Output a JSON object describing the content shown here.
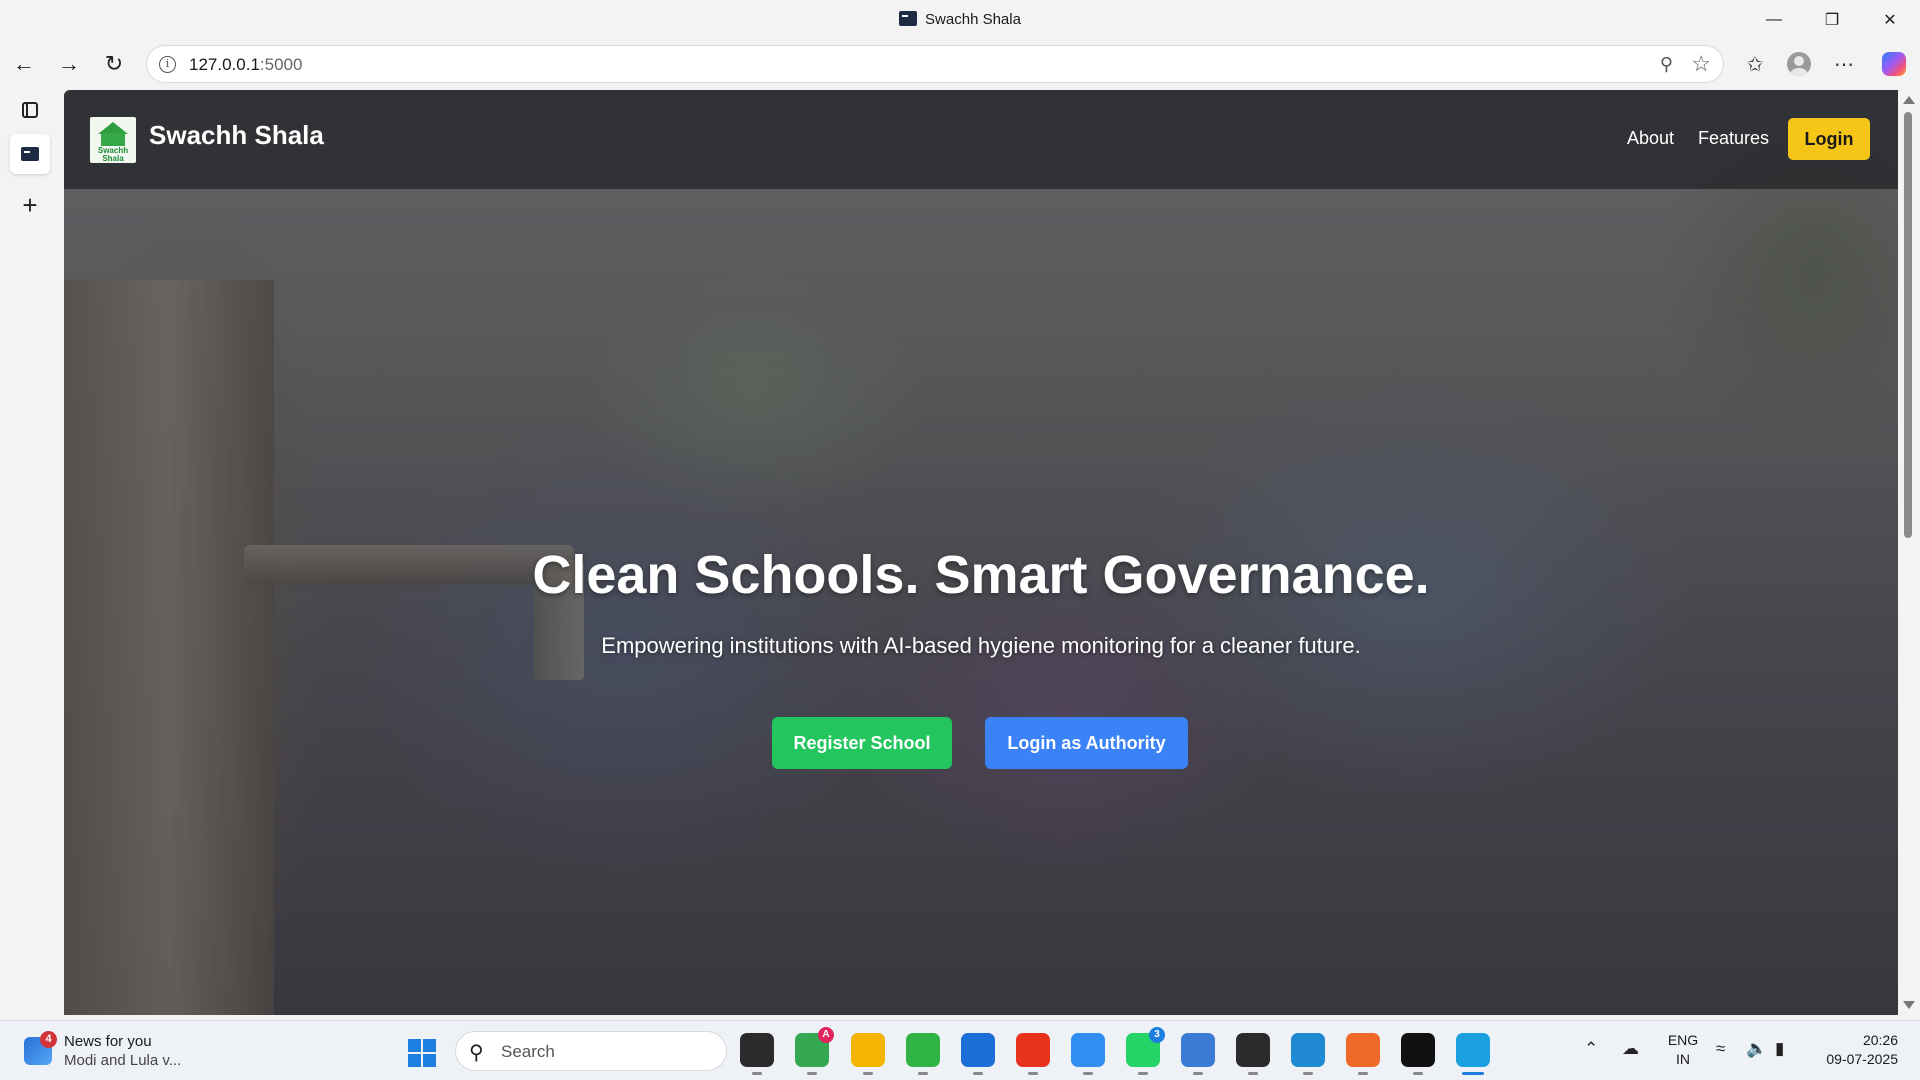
{
  "browser": {
    "window_title": "Swachh Shala",
    "url_host": "127.0.0.1",
    "url_port": ":5000"
  },
  "site": {
    "logo_text": [
      "Swachh",
      "Shala"
    ],
    "brand": "Swachh Shala",
    "nav": {
      "about": "About",
      "features": "Features",
      "login": "Login"
    },
    "hero": {
      "title": "Clean Schools. Smart Governance.",
      "subtitle": "Empowering institutions with AI-based hygiene monitoring for a cleaner future.",
      "register_button": "Register School",
      "authority_button": "Login as Authority"
    }
  },
  "taskbar": {
    "news": {
      "badge": "4",
      "title": "News for you",
      "headline": "Modi and Lula v..."
    },
    "search_label": "Search",
    "apps": [
      {
        "name": "task-view-icon",
        "color": "#2b2b2b"
      },
      {
        "name": "chrome-icon",
        "color": "#34a853",
        "badge": "A"
      },
      {
        "name": "file-explorer-icon",
        "color": "#f4b400"
      },
      {
        "name": "sync-icon",
        "color": "#2fb344"
      },
      {
        "name": "microsoft-store-icon",
        "color": "#1c6fd6"
      },
      {
        "name": "git-icon",
        "color": "#e8321d"
      },
      {
        "name": "weather-icon",
        "color": "#2f8ef0"
      },
      {
        "name": "whatsapp-icon",
        "color": "#25d366",
        "badge": "3"
      },
      {
        "name": "window-app-icon",
        "color": "#3a7bd5"
      },
      {
        "name": "terminal-icon",
        "color": "#2b2b2b"
      },
      {
        "name": "vscode-icon",
        "color": "#1f8ad2"
      },
      {
        "name": "postman-icon",
        "color": "#ef6a2a"
      },
      {
        "name": "cmd-icon",
        "color": "#111111"
      },
      {
        "name": "edge-icon",
        "color": "#1aa0e0"
      }
    ],
    "lang": [
      "ENG",
      "IN"
    ],
    "time": "20:26",
    "date": "09-07-2025"
  },
  "colors": {
    "login_button": "#f5c518",
    "register_button": "#22c55e",
    "authority_button": "#3b82f6"
  }
}
